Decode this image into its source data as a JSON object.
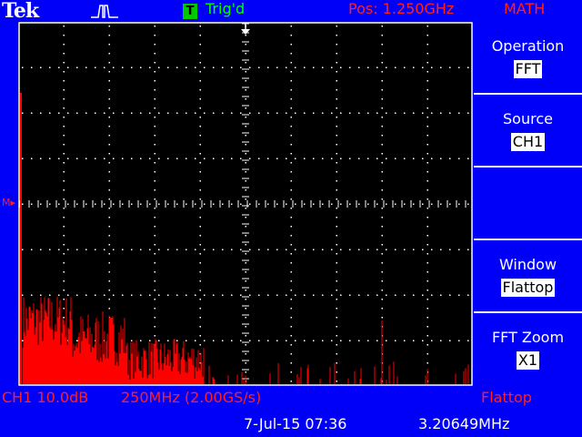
{
  "header": {
    "brand": "Tek",
    "trigger_badge": "T",
    "trigger_status": "Trig'd",
    "position": "Pos: 1.250GHz",
    "menu_title": "MATH"
  },
  "menu": {
    "items": [
      {
        "label": "Operation",
        "value": "FFT"
      },
      {
        "label": "Source",
        "value": "CH1"
      },
      {
        "label": "",
        "value": ""
      },
      {
        "label": "Window",
        "value": "Flattop"
      },
      {
        "label": "FFT Zoom",
        "value": "X1"
      }
    ]
  },
  "status": {
    "channel": "CH1 10.0dB",
    "span": "250MHz (2.00GS/s)",
    "window": "Flattop",
    "date_time": "7-Jul-15 07:36",
    "frequency": "3.20649MHz"
  },
  "display": {
    "marker_label": "M",
    "trace_color": "#ff0000",
    "grid_color": "#ffffff",
    "background": "#0000f8"
  }
}
